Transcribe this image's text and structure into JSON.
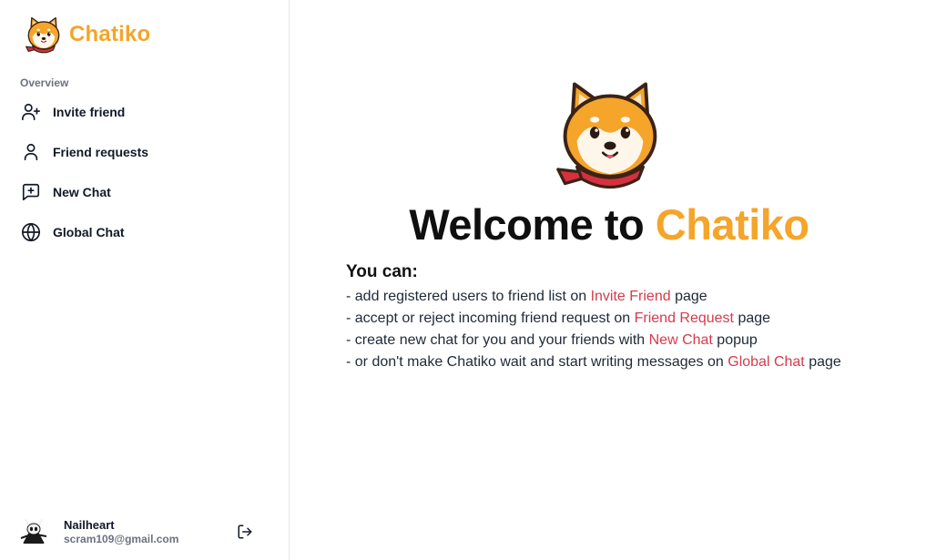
{
  "brand": {
    "name": "Chatiko",
    "accent_color": "#f4a52a"
  },
  "sidebar": {
    "section_label": "Overview",
    "items": [
      {
        "label": "Invite friend",
        "icon": "user-plus-icon"
      },
      {
        "label": "Friend requests",
        "icon": "user-icon"
      },
      {
        "label": "New Chat",
        "icon": "message-plus-icon"
      },
      {
        "label": "Global Chat",
        "icon": "globe-icon"
      }
    ]
  },
  "user": {
    "name": "Nailheart",
    "email": "scram109@gmail.com",
    "logout_icon": "logout-icon"
  },
  "main": {
    "welcome_prefix": "Welcome to",
    "welcome_brand": "Chatiko",
    "you_can": "You can:",
    "lines": [
      {
        "pre": "- add registered users to friend list on ",
        "link": "Invite Friend",
        "post": " page"
      },
      {
        "pre": "- accept or reject incoming friend request on ",
        "link": "Friend Request",
        "post": " page"
      },
      {
        "pre": "- create new chat for you and your friends with ",
        "link": "New Chat",
        "post": " popup"
      },
      {
        "pre": "- or don't make Chatiko wait and start writing messages on ",
        "link": "Global Chat",
        "post": " page"
      }
    ],
    "link_color": "#d63a4d"
  }
}
